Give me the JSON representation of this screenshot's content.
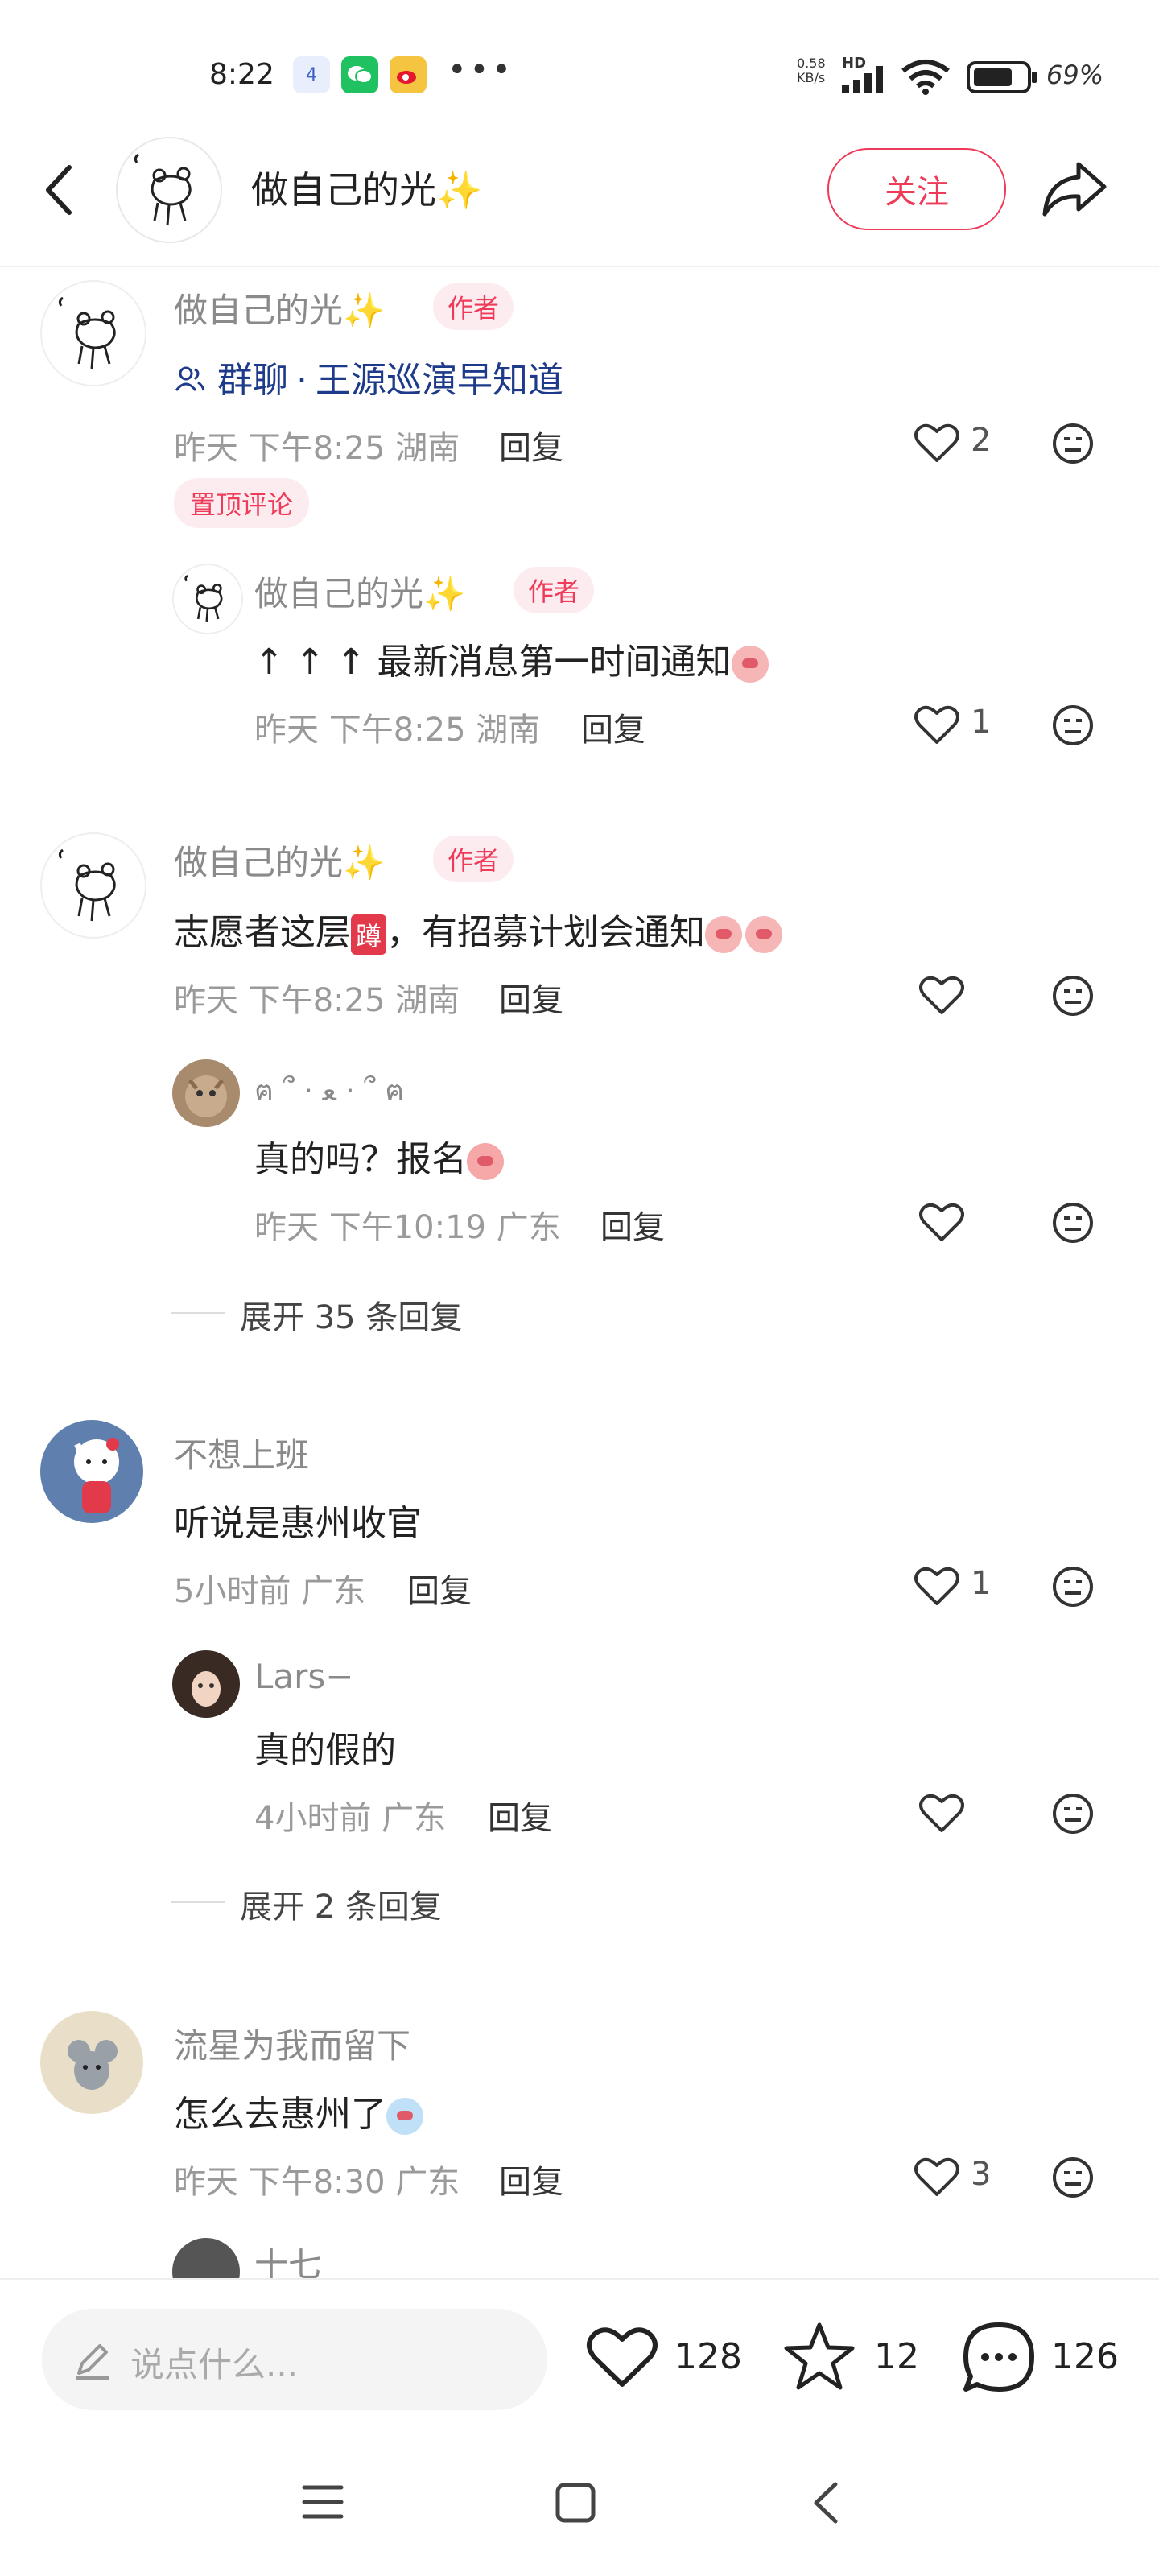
{
  "status_bar": {
    "time": "8:22",
    "notification_badge": "4",
    "network_speed": "0.58",
    "network_unit": "KB/s",
    "network_type": "HD",
    "battery": "69%"
  },
  "header": {
    "title": "做自己的光",
    "title_emoji": "✨",
    "follow_label": "关注"
  },
  "comments": [
    {
      "author": "做自己的光",
      "author_emoji": "✨",
      "tag": "作者",
      "group_prefix": "群聊",
      "group_name": "王源巡演早知道",
      "time": "昨天 下午8:25 湖南",
      "reply_label": "回复",
      "likes": "2",
      "pinned_label": "置顶评论",
      "replies": [
        {
          "author": "做自己的光",
          "author_emoji": "✨",
          "tag": "作者",
          "text": "↑ ↑ ↑ 最新消息第一时间通知",
          "time": "昨天 下午8:25 湖南",
          "reply_label": "回复",
          "likes": "1"
        }
      ]
    },
    {
      "author": "做自己的光",
      "author_emoji": "✨",
      "tag": "作者",
      "text_a": "志愿者这层",
      "sticker": "蹲",
      "text_b": "，有招募计划会通知",
      "time": "昨天 下午8:25 湖南",
      "reply_label": "回复",
      "replies": [
        {
          "author": "ฅ ՞ · ﻌ · ՞ ฅ",
          "text": "真的吗？报名",
          "time": "昨天 下午10:19 广东",
          "reply_label": "回复"
        }
      ],
      "expand_label": "展开 35 条回复"
    },
    {
      "author": "不想上班",
      "text": "听说是惠州收官",
      "time": "5小时前 广东",
      "reply_label": "回复",
      "likes": "1",
      "replies": [
        {
          "author": "Lars−",
          "text": "真的假的",
          "time": "4小时前 广东",
          "reply_label": "回复"
        }
      ],
      "expand_label": "展开 2 条回复"
    },
    {
      "author": "流星为我而留下",
      "text": "怎么去惠州了",
      "time": "昨天 下午8:30 广东",
      "reply_label": "回复",
      "likes": "3",
      "replies": [
        {
          "author": "十七"
        }
      ]
    }
  ],
  "bottom_bar": {
    "input_placeholder": "说点什么...",
    "likes": "128",
    "favorites": "12",
    "comments": "126"
  },
  "colors": {
    "accent": "#ef3b5a",
    "tag_bg": "#fdecef",
    "link": "#1e3a8a"
  }
}
